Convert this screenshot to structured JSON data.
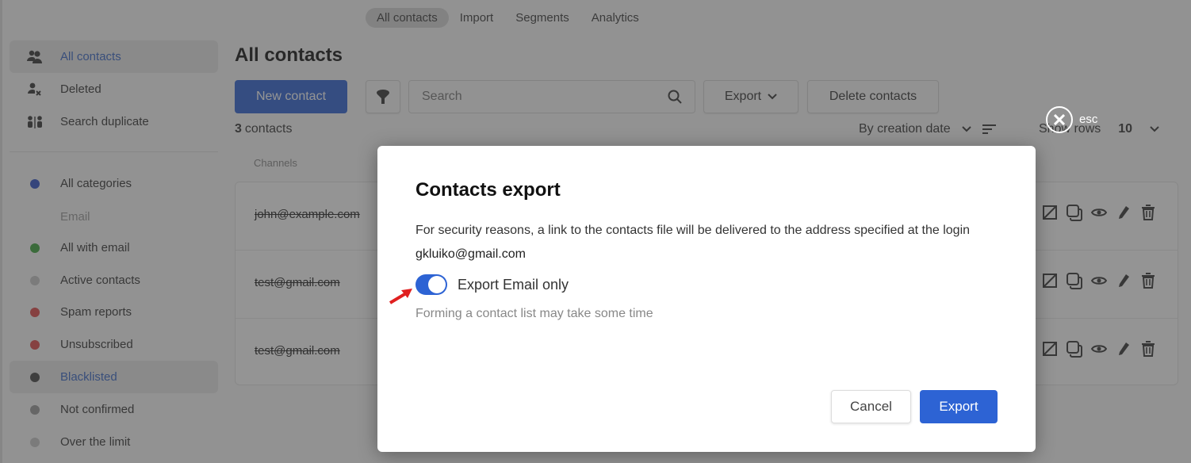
{
  "top_tabs": [
    {
      "label": "All contacts",
      "active": true
    },
    {
      "label": "Import"
    },
    {
      "label": "Segments"
    },
    {
      "label": "Analytics"
    }
  ],
  "sidebar": {
    "nav": [
      {
        "label": "All contacts",
        "icon": "users-icon",
        "active": true
      },
      {
        "label": "Deleted",
        "icon": "user-delete-icon"
      },
      {
        "label": "Search duplicate",
        "icon": "duplicate-users-icon"
      }
    ],
    "categories_label": "All categories",
    "email_heading": "Email",
    "filters": [
      {
        "label": "All with email",
        "color": "#3aa53a"
      },
      {
        "label": "Active contacts",
        "color": "#c8c8c8"
      },
      {
        "label": "Spam reports",
        "color": "#e04848"
      },
      {
        "label": "Unsubscribed",
        "color": "#e04848"
      },
      {
        "label": "Blacklisted",
        "color": "#444444",
        "active": true
      },
      {
        "label": "Not confirmed",
        "color": "#9a9a9a"
      },
      {
        "label": "Over the limit",
        "color": "#c8c8c8"
      }
    ],
    "categories_color": "#2d50c8"
  },
  "main": {
    "title": "All contacts",
    "new_contact_label": "New contact",
    "search_placeholder": "Search",
    "export_label": "Export",
    "delete_label": "Delete contacts",
    "count_number": "3",
    "count_label": "contacts",
    "sort_label": "By creation date",
    "show_rows_label": "Show rows",
    "show_rows_value": "10",
    "column_channels": "Channels",
    "rows": [
      {
        "email": "john@example.com"
      },
      {
        "email": "test@gmail.com"
      },
      {
        "email": "test@gmail.com"
      }
    ]
  },
  "esc_label": "esc",
  "modal": {
    "title": "Contacts export",
    "description": "For security reasons, a link to the contacts file will be delivered to the address specified at the login",
    "email": "gkluiko@gmail.com",
    "toggle_label": "Export Email only",
    "toggle_on": true,
    "hint": "Forming a contact list may take some time",
    "cancel_label": "Cancel",
    "export_label": "Export"
  }
}
